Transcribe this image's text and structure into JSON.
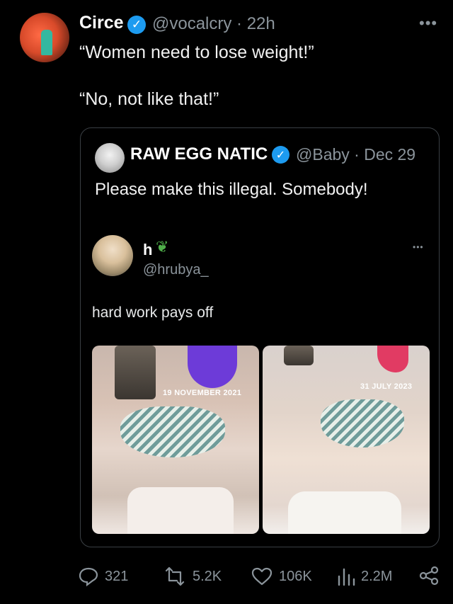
{
  "tweet": {
    "author_name": "Circe",
    "handle_time": "@vocalcry · 22h",
    "text_line1": "“Women need to lose weight!”",
    "text_line2": "“No, not like that!”"
  },
  "quote": {
    "author_name": "RAW EGG NATIC",
    "handle_time": "@Baby · Dec 29",
    "text": "Please make this illegal. Somebody!",
    "embedded": {
      "author_name": "h",
      "handle": "@hrubya_",
      "text": "hard work pays off",
      "photo_labels": [
        "19 NOVEMBER 2021",
        "31 JULY 2023"
      ]
    }
  },
  "actions": {
    "replies": "321",
    "reposts": "5.2K",
    "likes": "106K",
    "views": "2.2M"
  },
  "colors": {
    "background": "#000000",
    "verified": "#1d9bf0",
    "muted": "#8b949b"
  },
  "icons": [
    "verified-badge-icon",
    "more-icon",
    "reply-icon",
    "repost-icon",
    "like-icon",
    "views-icon",
    "share-icon",
    "leaf-emoji-icon"
  ]
}
